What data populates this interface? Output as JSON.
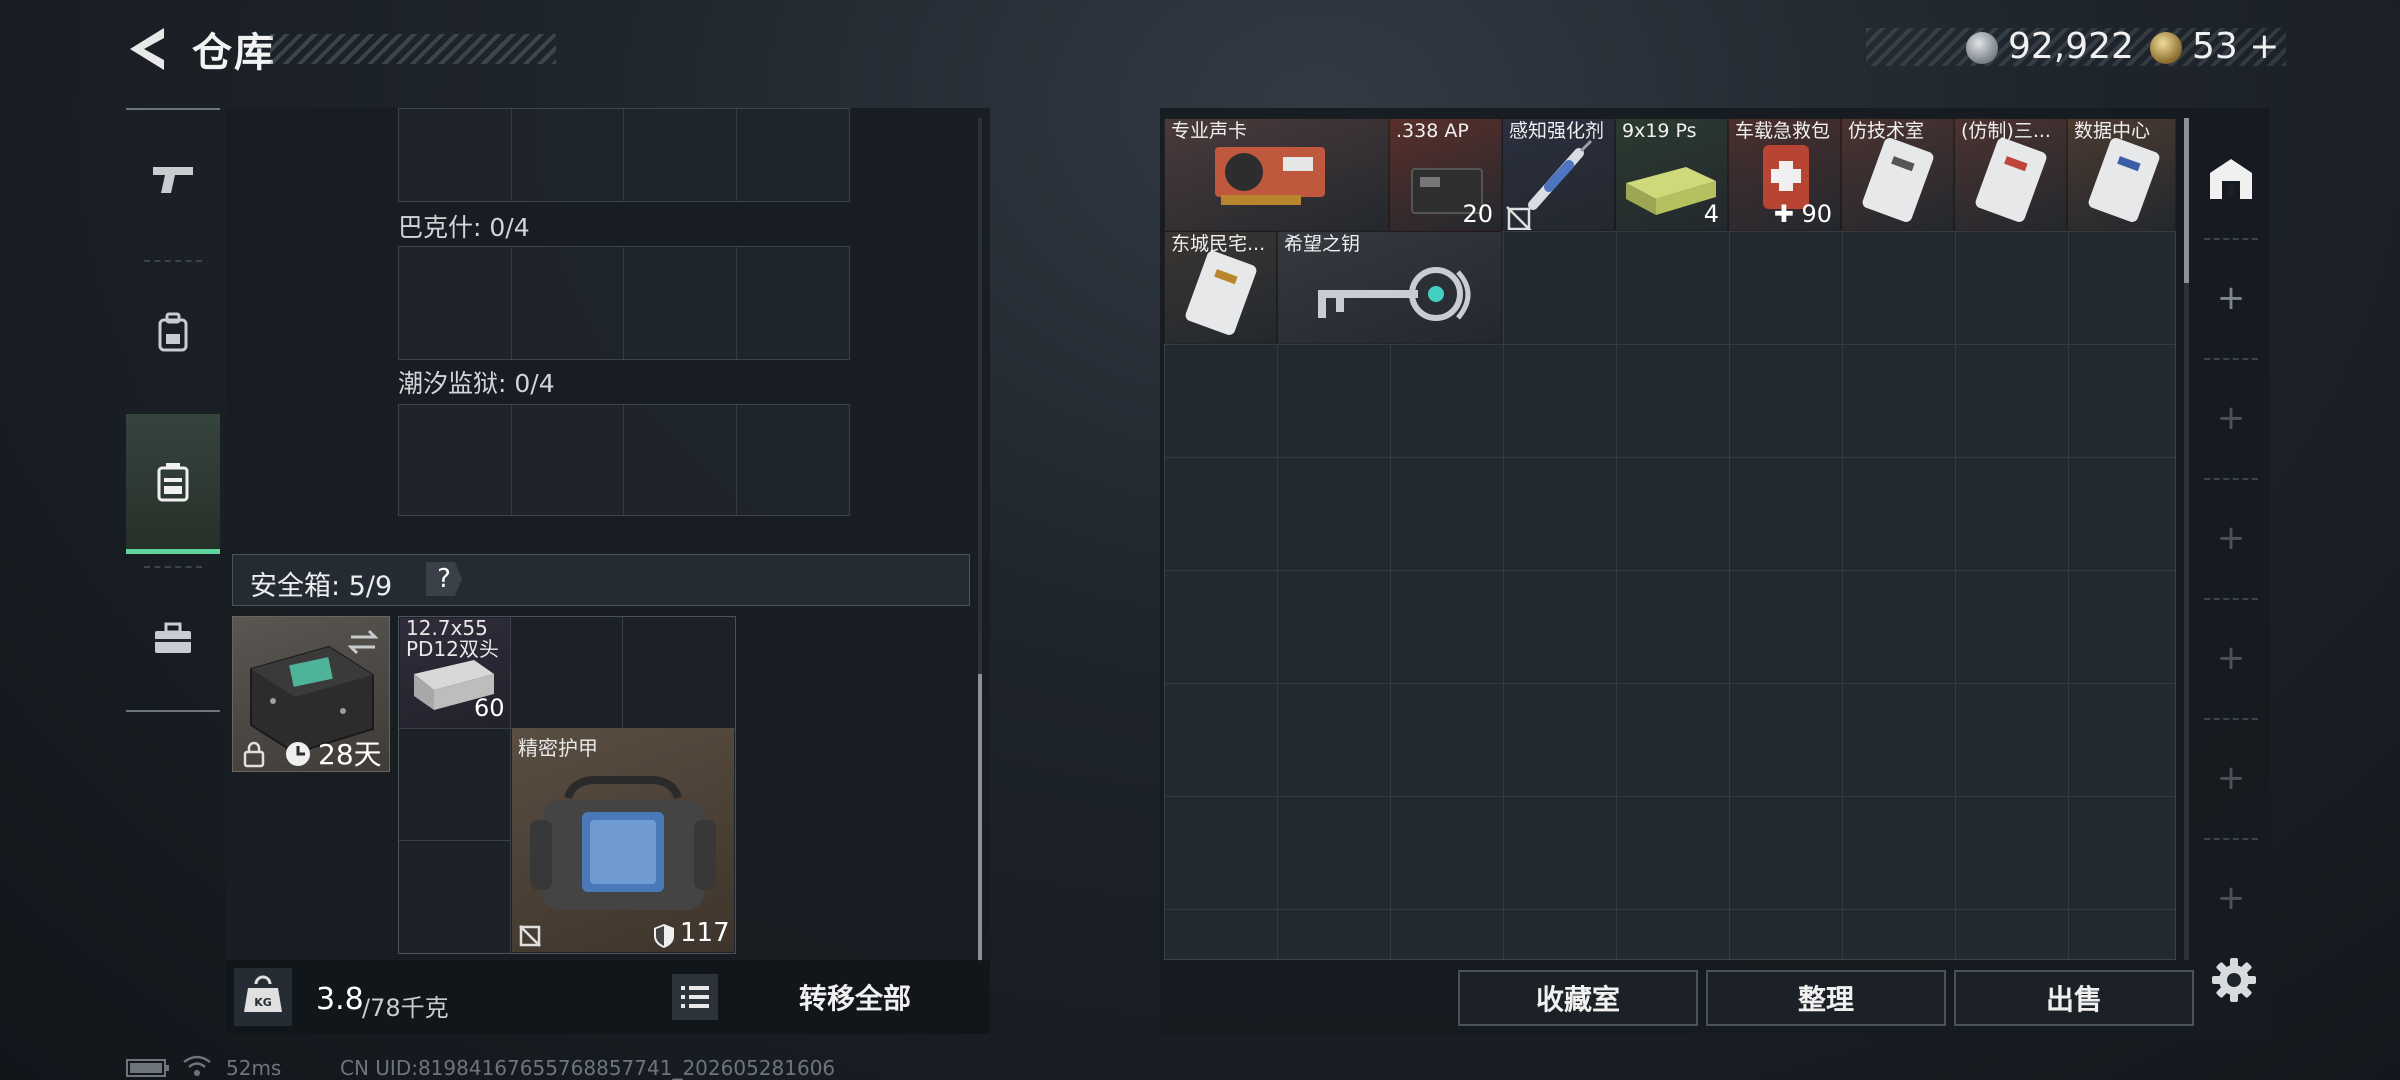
{
  "header": {
    "title": "仓库",
    "silver_value": "92,922",
    "gold_value": "53",
    "gold_plus": "+"
  },
  "side_tabs": [
    {
      "name": "weapons",
      "icon": "pistol-icon"
    },
    {
      "name": "gear",
      "icon": "backpack-icon"
    },
    {
      "name": "containers",
      "icon": "container-icon",
      "active": true
    },
    {
      "name": "toolkit",
      "icon": "toolbox-icon"
    }
  ],
  "left_panel": {
    "sections": [
      {
        "label": "巴克什: 0/4"
      },
      {
        "label": "潮汐监狱: 0/4"
      }
    ],
    "safebox": {
      "label": "安全箱: 5/9",
      "help": "?",
      "case_days": "28天",
      "items": [
        {
          "name": "12.7x55 PD12双头",
          "count": "60"
        },
        {
          "name": "精密护甲",
          "durability": "117"
        }
      ]
    },
    "weight": {
      "value": "3.8",
      "capacity": "/78千克"
    },
    "transfer_label": "转移全部"
  },
  "stash": {
    "items": [
      {
        "name": "专业声卡",
        "count": "",
        "color": "#4a3a3a"
      },
      {
        "name": ".338 AP",
        "count": "20",
        "color": "#5a2f2a"
      },
      {
        "name": "感知强化剂",
        "count": "",
        "color": "#2b2f3f"
      },
      {
        "name": "9x19 Ps",
        "count": "4",
        "color": "#2b3a2f"
      },
      {
        "name": "车载急救包",
        "count": "90",
        "color": "#4a2f2d"
      },
      {
        "name": "仿技术室",
        "count": "",
        "color": "#4b3330"
      },
      {
        "name": "(仿制)三...",
        "count": "",
        "color": "#4b3330"
      },
      {
        "name": "数据中心",
        "count": "",
        "color": "#4b3a30"
      },
      {
        "name": "东城民宅...",
        "count": "",
        "color": "#3a3632"
      },
      {
        "name": "希望之钥",
        "count": "",
        "color": "#353a40"
      }
    ]
  },
  "actions": {
    "collection_label": "收藏室",
    "sort_label": "整理",
    "sell_label": "出售"
  },
  "status": {
    "ping": "52ms",
    "uid": "CN UID:8198416765576885774​1_202605281606"
  }
}
